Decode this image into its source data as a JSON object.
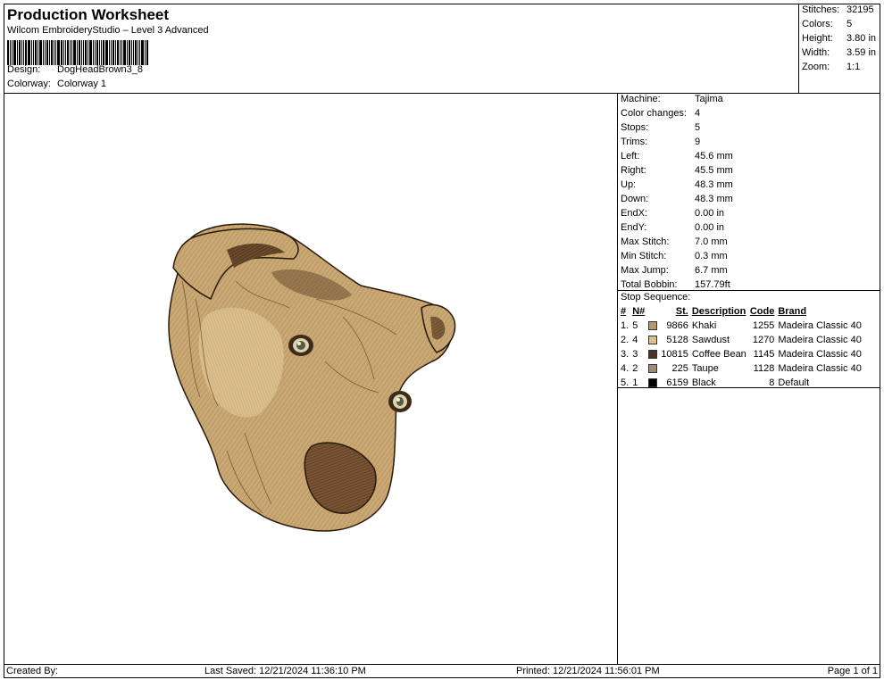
{
  "header": {
    "title": "Production Worksheet",
    "subtitle": "Wilcom EmbroideryStudio – Level 3 Advanced",
    "design_label": "Design:",
    "design_value": "DogHeadBrown3_8",
    "colorway_label": "Colorway:",
    "colorway_value": "Colorway 1"
  },
  "stats": [
    {
      "label": "Stitches:",
      "value": "32195"
    },
    {
      "label": "Colors:",
      "value": "5"
    },
    {
      "label": "Height:",
      "value": "3.80 in"
    },
    {
      "label": "Width:",
      "value": "3.59 in"
    },
    {
      "label": "Zoom:",
      "value": "1:1"
    }
  ],
  "machine_info": [
    {
      "label": "Machine:",
      "value": "Tajima"
    },
    {
      "label": "Color changes:",
      "value": "4"
    },
    {
      "label": "Stops:",
      "value": "5"
    },
    {
      "label": "Trims:",
      "value": "9"
    },
    {
      "label": "Left:",
      "value": "45.6 mm"
    },
    {
      "label": "Right:",
      "value": "45.5 mm"
    },
    {
      "label": "Up:",
      "value": "48.3 mm"
    },
    {
      "label": "Down:",
      "value": "48.3 mm"
    },
    {
      "label": "EndX:",
      "value": "0.00 in"
    },
    {
      "label": "EndY:",
      "value": "0.00 in"
    },
    {
      "label": "Max Stitch:",
      "value": "7.0 mm"
    },
    {
      "label": "Min Stitch:",
      "value": "0.3 mm"
    },
    {
      "label": "Max Jump:",
      "value": "6.7 mm"
    },
    {
      "label": "Total Bobbin:",
      "value": "157.79ft"
    }
  ],
  "stop_sequence": {
    "title": "Stop Sequence:",
    "columns": [
      "#",
      "N#",
      "St.",
      "Description",
      "Code",
      "Brand"
    ],
    "rows": [
      {
        "idx": "1.",
        "n": "5",
        "color": "#b89a6a",
        "st": "9866",
        "desc": "Khaki",
        "code": "1255",
        "brand": "Madeira Classic 40"
      },
      {
        "idx": "2.",
        "n": "4",
        "color": "#dcc08a",
        "st": "5128",
        "desc": "Sawdust",
        "code": "1270",
        "brand": "Madeira Classic 40"
      },
      {
        "idx": "3.",
        "n": "3",
        "color": "#4a3424",
        "st": "10815",
        "desc": "Coffee Bean",
        "code": "1145",
        "brand": "Madeira Classic 40"
      },
      {
        "idx": "4.",
        "n": "2",
        "color": "#9c8c78",
        "st": "225",
        "desc": "Taupe",
        "code": "1128",
        "brand": "Madeira Classic 40"
      },
      {
        "idx": "5.",
        "n": "1",
        "color": "#000000",
        "st": "6159",
        "desc": "Black",
        "code": "8",
        "brand": "Default"
      }
    ]
  },
  "footer": {
    "created_by": "Created By:",
    "last_saved": "Last Saved: 12/21/2024 11:36:10 PM",
    "printed": "Printed: 12/21/2024 11:56:01 PM",
    "page": "Page 1 of 1"
  }
}
